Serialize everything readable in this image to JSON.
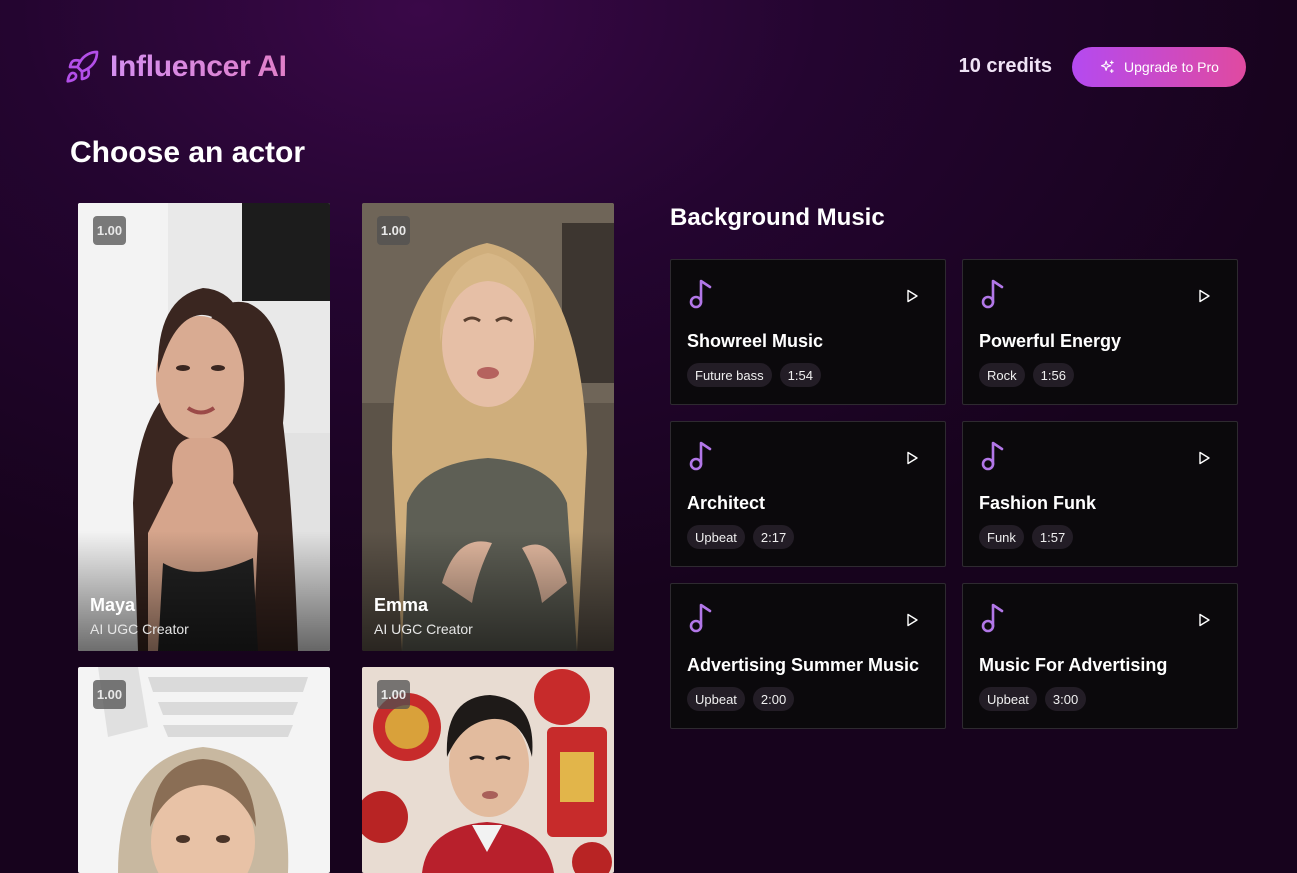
{
  "app": {
    "name": "Influencer AI",
    "credits": "10 credits",
    "upgrade_label": "Upgrade to Pro"
  },
  "page_title": "Choose an actor",
  "actors": [
    {
      "name": "Maya",
      "role": "AI UGC Creator",
      "score": "1.00"
    },
    {
      "name": "Emma",
      "role": "AI UGC Creator",
      "score": "1.00"
    },
    {
      "name": "",
      "role": "",
      "score": "1.00"
    },
    {
      "name": "",
      "role": "",
      "score": "1.00"
    }
  ],
  "music": {
    "title": "Background Music",
    "tracks": [
      {
        "name": "Showreel Music",
        "genre": "Future bass",
        "duration": "1:54"
      },
      {
        "name": "Powerful Energy",
        "genre": "Rock",
        "duration": "1:56"
      },
      {
        "name": "Architect",
        "genre": "Upbeat",
        "duration": "2:17"
      },
      {
        "name": "Fashion Funk",
        "genre": "Funk",
        "duration": "1:57"
      },
      {
        "name": "Advertising Summer Music",
        "genre": "Upbeat",
        "duration": "2:00"
      },
      {
        "name": "Music For Advertising",
        "genre": "Upbeat",
        "duration": "3:00"
      }
    ]
  },
  "colors": {
    "accent": "#b44af0",
    "accent_pink": "#e04aa0",
    "note_icon": "#b277e8",
    "background": "#240530"
  },
  "icons": {
    "logo": "rocket-icon",
    "upgrade": "sparkles-icon",
    "track": "music-note-icon",
    "play": "play-icon"
  }
}
